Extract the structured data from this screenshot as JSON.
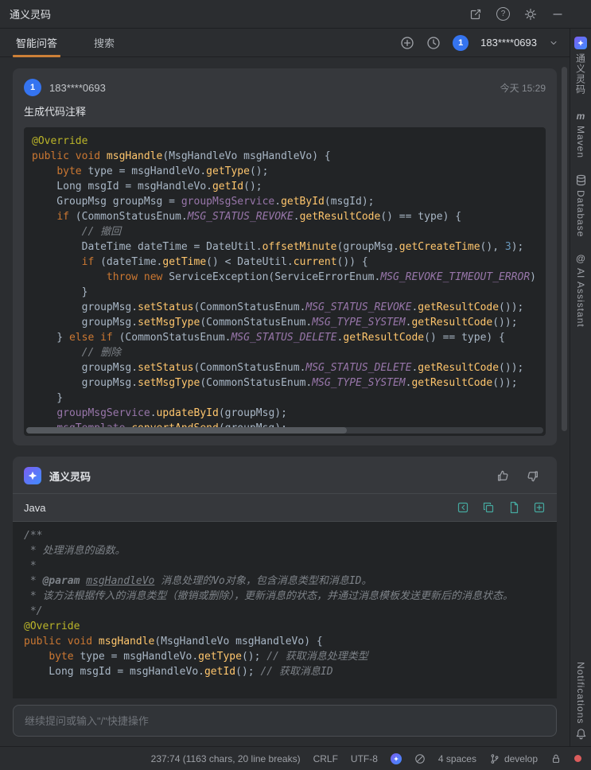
{
  "titlebar": {
    "title": "通义灵码"
  },
  "tabbar": {
    "tab_qa": "智能问答",
    "tab_search": "搜索",
    "avatar_badge": "1",
    "account": "183****0693"
  },
  "glyphs": {
    "help": "?",
    "maven": "m",
    "ai_at": "@"
  },
  "right_strip": {
    "tongyi": "通义灵码",
    "maven": "Maven",
    "database": "Database",
    "ai_assistant": "AI Assistant",
    "notifications": "Notifications"
  },
  "user_message": {
    "avatar": "1",
    "name": "183****0693",
    "time": "今天 15:29",
    "text": "生成代码注释"
  },
  "code_request": {
    "lines": [
      [
        [
          "a",
          "@Override"
        ]
      ],
      [
        [
          "k",
          "public void "
        ],
        [
          "m",
          "msgHandle"
        ],
        [
          "p",
          "(MsgHandleVo msgHandleVo) {"
        ]
      ],
      [
        [
          "p",
          "    "
        ],
        [
          "k",
          "byte"
        ],
        [
          "p",
          " type = msgHandleVo."
        ],
        [
          "m",
          "getType"
        ],
        [
          "p",
          "();"
        ]
      ],
      [
        [
          "p",
          "    Long msgId = msgHandleVo."
        ],
        [
          "m",
          "getId"
        ],
        [
          "p",
          "();"
        ]
      ],
      [
        [
          "p",
          "    GroupMsg groupMsg = "
        ],
        [
          "f",
          "groupMsgService"
        ],
        [
          "p",
          "."
        ],
        [
          "m",
          "getById"
        ],
        [
          "p",
          "(msgId);"
        ]
      ],
      [
        [
          "p",
          "    "
        ],
        [
          "k",
          "if"
        ],
        [
          "p",
          " (CommonStatusEnum."
        ],
        [
          "kc",
          "MSG_STATUS_REVOKE"
        ],
        [
          "p",
          "."
        ],
        [
          "m",
          "getResultCode"
        ],
        [
          "p",
          "() == type) {"
        ]
      ],
      [
        [
          "c",
          "        // 撤回"
        ]
      ],
      [
        [
          "p",
          "        DateTime dateTime = DateUtil."
        ],
        [
          "m",
          "offsetMinute"
        ],
        [
          "p",
          "(groupMsg."
        ],
        [
          "m",
          "getCreateTime"
        ],
        [
          "p",
          "(), "
        ],
        [
          "n",
          "3"
        ],
        [
          "p",
          ");"
        ]
      ],
      [
        [
          "p",
          "        "
        ],
        [
          "k",
          "if"
        ],
        [
          "p",
          " (dateTime."
        ],
        [
          "m",
          "getTime"
        ],
        [
          "p",
          "() < DateUtil."
        ],
        [
          "m",
          "current"
        ],
        [
          "p",
          "()) {"
        ]
      ],
      [
        [
          "p",
          "            "
        ],
        [
          "k",
          "throw new "
        ],
        [
          "p",
          "ServiceException(ServiceErrorEnum."
        ],
        [
          "kc",
          "MSG_REVOKE_TIMEOUT_ERROR"
        ],
        [
          "p",
          ")"
        ]
      ],
      [
        [
          "p",
          "        }"
        ]
      ],
      [
        [
          "p",
          "        groupMsg."
        ],
        [
          "m",
          "setStatus"
        ],
        [
          "p",
          "(CommonStatusEnum."
        ],
        [
          "kc",
          "MSG_STATUS_REVOKE"
        ],
        [
          "p",
          "."
        ],
        [
          "m",
          "getResultCode"
        ],
        [
          "p",
          "());"
        ]
      ],
      [
        [
          "p",
          "        groupMsg."
        ],
        [
          "m",
          "setMsgType"
        ],
        [
          "p",
          "(CommonStatusEnum."
        ],
        [
          "kc",
          "MSG_TYPE_SYSTEM"
        ],
        [
          "p",
          "."
        ],
        [
          "m",
          "getResultCode"
        ],
        [
          "p",
          "());"
        ]
      ],
      [
        [
          "p",
          "    } "
        ],
        [
          "k",
          "else if"
        ],
        [
          "p",
          " (CommonStatusEnum."
        ],
        [
          "kc",
          "MSG_STATUS_DELETE"
        ],
        [
          "p",
          "."
        ],
        [
          "m",
          "getResultCode"
        ],
        [
          "p",
          "() == type) {"
        ]
      ],
      [
        [
          "c",
          "        // 删除"
        ]
      ],
      [
        [
          "p",
          "        groupMsg."
        ],
        [
          "m",
          "setStatus"
        ],
        [
          "p",
          "(CommonStatusEnum."
        ],
        [
          "kc",
          "MSG_STATUS_DELETE"
        ],
        [
          "p",
          "."
        ],
        [
          "m",
          "getResultCode"
        ],
        [
          "p",
          "());"
        ]
      ],
      [
        [
          "p",
          "        groupMsg."
        ],
        [
          "m",
          "setMsgType"
        ],
        [
          "p",
          "(CommonStatusEnum."
        ],
        [
          "kc",
          "MSG_TYPE_SYSTEM"
        ],
        [
          "p",
          "."
        ],
        [
          "m",
          "getResultCode"
        ],
        [
          "p",
          "());"
        ]
      ],
      [
        [
          "p",
          "    }"
        ]
      ],
      [
        [
          "p",
          "    "
        ],
        [
          "f",
          "groupMsgService"
        ],
        [
          "p",
          "."
        ],
        [
          "m",
          "updateById"
        ],
        [
          "p",
          "(groupMsg);"
        ]
      ],
      [
        [
          "p",
          "    "
        ],
        [
          "f",
          "msgTemplate"
        ],
        [
          "p",
          "."
        ],
        [
          "m",
          "convertAndSend"
        ],
        [
          "p",
          "(groupMsg);"
        ]
      ]
    ]
  },
  "assistant": {
    "name": "通义灵码",
    "language": "Java"
  },
  "code_response": {
    "lines": [
      [
        [
          "c",
          "/**"
        ]
      ],
      [
        [
          "c",
          " * 处理消息的函数。"
        ]
      ],
      [
        [
          "c",
          " *"
        ]
      ],
      [
        [
          "c",
          " * "
        ],
        [
          "ct",
          "@param"
        ],
        [
          "c",
          " "
        ],
        [
          "cp",
          "msgHandleVo"
        ],
        [
          "c",
          " 消息处理的Vo对象，包含消息类型和消息ID。"
        ]
      ],
      [
        [
          "c",
          " * 该方法根据传入的消息类型（撤销或删除），更新消息的状态，并通过消息模板发送更新后的消息状态。"
        ]
      ],
      [
        [
          "c",
          " */"
        ]
      ],
      [
        [
          "a",
          "@Override"
        ]
      ],
      [
        [
          "k",
          "public void "
        ],
        [
          "m",
          "msgHandle"
        ],
        [
          "p",
          "(MsgHandleVo msgHandleVo) {"
        ]
      ],
      [
        [
          "p",
          "    "
        ],
        [
          "k",
          "byte"
        ],
        [
          "p",
          " type = msgHandleVo."
        ],
        [
          "m",
          "getType"
        ],
        [
          "p",
          "(); "
        ],
        [
          "c",
          "// 获取消息处理类型"
        ]
      ],
      [
        [
          "p",
          "    Long msgId = msgHandleVo."
        ],
        [
          "m",
          "getId"
        ],
        [
          "p",
          "(); "
        ],
        [
          "c",
          "// 获取消息ID"
        ]
      ]
    ]
  },
  "composer": {
    "placeholder": "继续提问或输入\"/\"快捷操作"
  },
  "statusbar": {
    "caret": "237:74 (1163 chars, 20 line breaks)",
    "line_sep": "CRLF",
    "encoding": "UTF-8",
    "indent": "4 spaces",
    "branch": "develop"
  },
  "colors": {
    "accent_tab_underline": "#cc8038",
    "avatar_blue": "#3574f0",
    "code_action_teal": "#45a89f",
    "error_red": "#db5c5c",
    "panel_bg": "#2b2d30",
    "card_bg": "#36383c",
    "code_bg": "#222426"
  }
}
